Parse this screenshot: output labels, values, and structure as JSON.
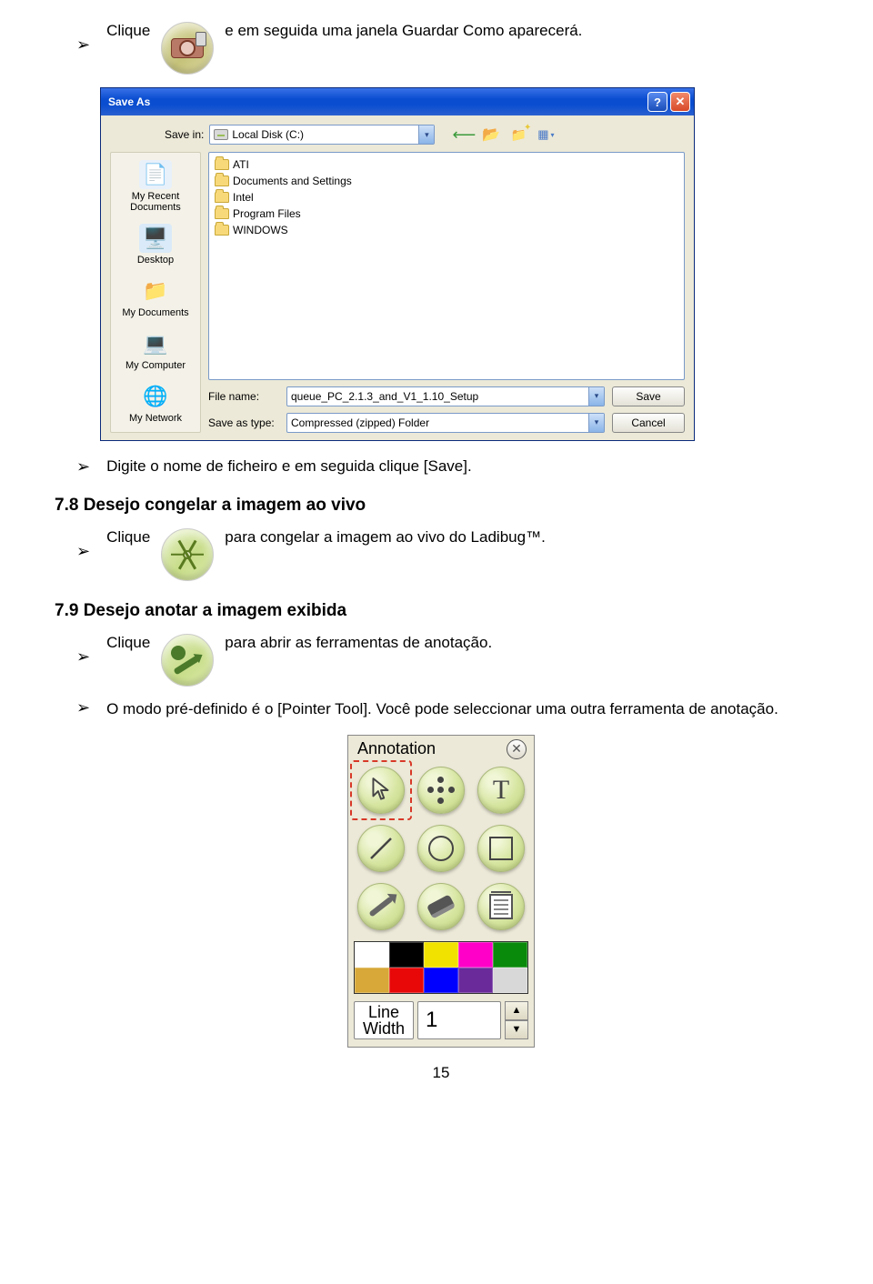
{
  "step1": {
    "prefix": "Clique",
    "suffix": "e em seguida uma janela Guardar Como aparecerá."
  },
  "dialog": {
    "title": "Save As",
    "savein_lbl": "Save in:",
    "savein_val": "Local Disk (C:)",
    "places": {
      "recent": "My Recent\nDocuments",
      "desktop": "Desktop",
      "mydocs": "My Documents",
      "mycomp": "My Computer",
      "network": "My Network"
    },
    "folders": [
      "ATI",
      "Documents and Settings",
      "Intel",
      "Program Files",
      "WINDOWS"
    ],
    "filename_lbl": "File name:",
    "filename_val": "queue_PC_2.1.3_and_V1_1.10_Setup",
    "type_lbl": "Save as type:",
    "type_val": "Compressed (zipped) Folder",
    "save_btn": "Save",
    "cancel_btn": "Cancel"
  },
  "step2": "Digite o nome de ficheiro e em seguida clique [Save].",
  "h78": "7.8 Desejo congelar a imagem ao vivo",
  "step3": {
    "prefix": "Clique",
    "suffix": "para congelar a imagem ao vivo do Ladibug™."
  },
  "h79": "7.9 Desejo anotar a imagem exibida",
  "step4": {
    "prefix": "Clique",
    "suffix": "para abrir as ferramentas de anotação."
  },
  "step5": "O modo pré-definido é o [Pointer Tool]. Você pode seleccionar uma outra ferramenta de anotação.",
  "anno": {
    "title": "Annotation",
    "line_label": "Line\nWidth",
    "line_val": "1",
    "swatches_row1": [
      "#ffffff",
      "#000000",
      "#f2e200",
      "#ff00c8",
      "#0a8a0a"
    ],
    "swatches_row2": [
      "#d8a838",
      "#e80808",
      "#0000ff",
      "#6a2a9a",
      "#d8d8d8"
    ]
  },
  "page": "15"
}
